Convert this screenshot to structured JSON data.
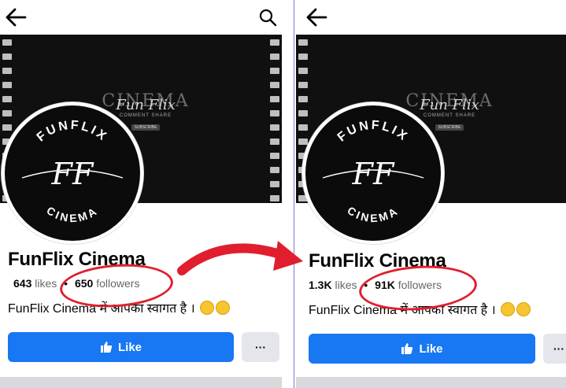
{
  "colors": {
    "like_button": "#1877f2",
    "annotation": "#e01e2e",
    "divider": "#8c6fd6"
  },
  "cover": {
    "title": "CINEMA",
    "script": "Fun Flix",
    "subtitle": "COMMENT  SHARE",
    "pill": "SUBSCRIBE"
  },
  "avatar": {
    "top_text": "FUNFLIX",
    "monogram": "FF",
    "bottom_text": "CINEMA"
  },
  "before": {
    "page_name": "FunFlix Cinema",
    "likes_count": "643",
    "likes_label": "likes",
    "separator": "•",
    "followers_count": "650",
    "followers_label": "followers",
    "bio": "FunFlix Cinema में आपका स्वागत है ।",
    "like_button_label": "Like",
    "more_button_label": "···"
  },
  "after": {
    "page_name": "FunFlix Cinema",
    "likes_count": "1.3K",
    "likes_label": "likes",
    "separator": "•",
    "followers_count": "91K",
    "followers_label": "followers",
    "bio": "FunFlix Cinema में आपका स्वागत है ।",
    "like_button_label": "Like",
    "more_button_label": "···"
  },
  "icons": {
    "back": "arrow-left-icon",
    "search": "search-icon",
    "thumbs_up": "thumbs-up-icon",
    "transition": "curved-arrow-icon"
  }
}
